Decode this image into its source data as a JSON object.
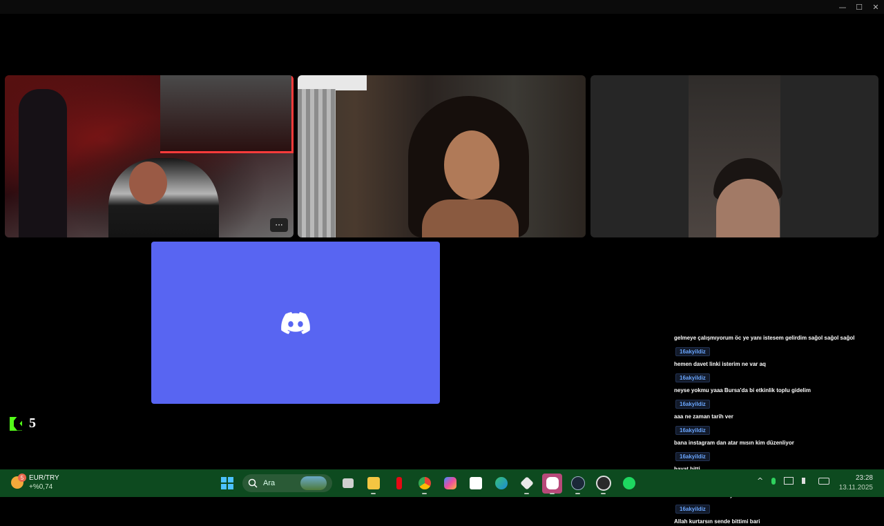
{
  "window": {
    "controls": {
      "minimize": "—",
      "maximize": "☐",
      "close": "✕"
    }
  },
  "tiles": {
    "tile1": {
      "more_label": "···"
    },
    "discord": {
      "icon": "discord-icon",
      "color": "#5865f2"
    }
  },
  "kick": {
    "icon": "kick-icon",
    "count": "5",
    "accent": "#53fc18"
  },
  "chat": {
    "messages": [
      {
        "user": "",
        "text": "gelmeye çalışmıyorum öc ye yanı istesem gelirdim sağol sağol sağol"
      },
      {
        "user": "16akyildiz",
        "text": "hemen davet linki isterim ne var aq"
      },
      {
        "user": "16akyildiz",
        "text": "neyse yokmu yaaa Bursa'da bi etkinlik toplu gidelim"
      },
      {
        "user": "16akyildiz",
        "text": "aaa ne zaman tarih ver"
      },
      {
        "user": "16akyildiz",
        "text": "bana instagram dan atar mısın kim düzenliyor"
      },
      {
        "user": "16akyildiz",
        "text": "hayat bitti"
      },
      {
        "user": "16akyildiz",
        "text": "bizim elemana noldu ya varmı ses"
      },
      {
        "user": "16akyildiz",
        "text": "Allah kurtarsın sende bittimi bari"
      }
    ]
  },
  "taskbar": {
    "widget": {
      "badge": "5",
      "symbol": "EUR/TRY",
      "change": "+%0,74"
    },
    "search_label": "Ara",
    "apps": [
      "start-icon",
      "search-icon",
      "task-view-icon",
      "file-explorer-icon",
      "netflix-icon",
      "chrome-icon",
      "copilot-icon",
      "microsoft-store-icon",
      "edge-icon",
      "app-icon",
      "discord-icon",
      "steam-icon",
      "obs-icon",
      "spotify-icon"
    ],
    "tray": {
      "chevron": "^",
      "time": "23:28",
      "date": "13.11.2025"
    }
  }
}
